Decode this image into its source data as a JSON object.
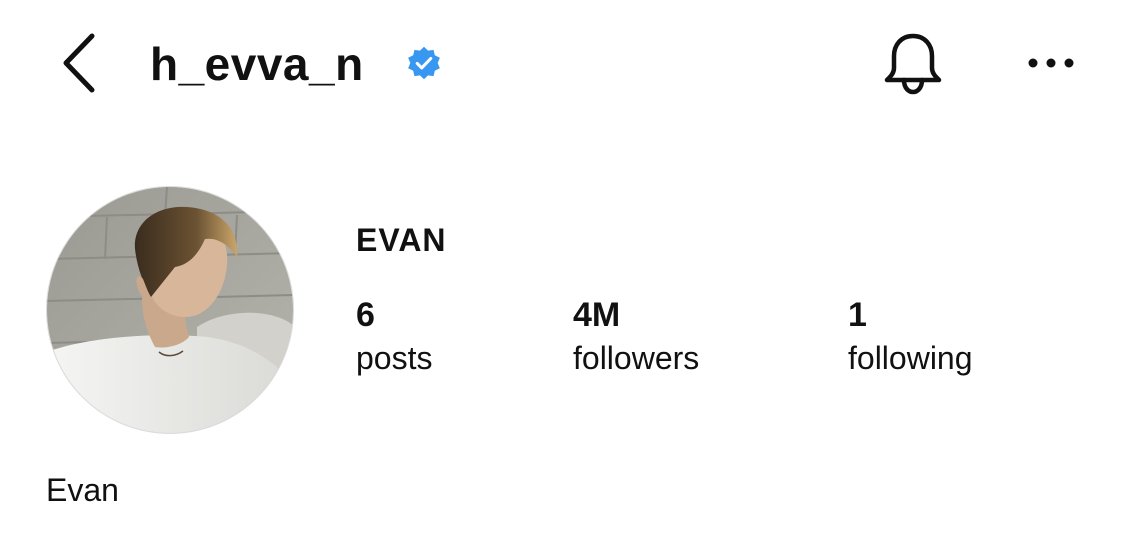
{
  "header": {
    "username": "h_evva_n",
    "verified": true,
    "back_icon": "chevron-left-icon",
    "verified_icon": "verified-badge-icon",
    "bell_icon": "bell-icon",
    "more_icon": "more-horizontal-icon",
    "verified_color": "#3897f0"
  },
  "profile": {
    "display_name": "EVAN",
    "bio_name": "Evan",
    "avatar_icon": "profile-photo"
  },
  "stats": {
    "posts": {
      "count": "6",
      "label": "posts"
    },
    "followers": {
      "count": "4M",
      "label": "followers"
    },
    "following": {
      "count": "1",
      "label": "following"
    }
  }
}
